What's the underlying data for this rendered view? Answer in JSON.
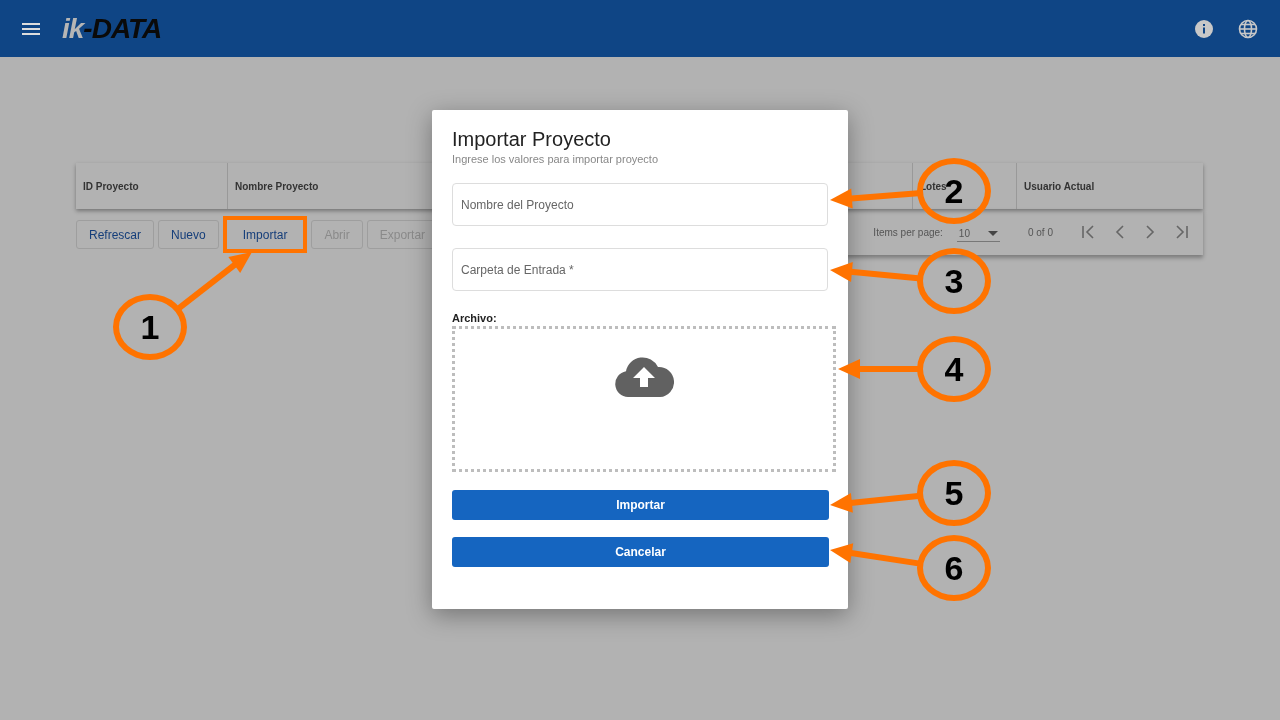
{
  "header": {
    "logo_prefix": "ik",
    "logo_suffix": "-DATA"
  },
  "table": {
    "columns": [
      "ID Proyecto",
      "Nombre Proyecto",
      "Lotes",
      "Usuario Actual"
    ]
  },
  "toolbar": [
    {
      "label": "Refrescar",
      "disabled": false,
      "highlighted": false
    },
    {
      "label": "Nuevo",
      "disabled": false,
      "highlighted": false
    },
    {
      "label": "Importar",
      "disabled": false,
      "highlighted": true
    },
    {
      "label": "Abrir",
      "disabled": true,
      "highlighted": false
    },
    {
      "label": "Exportar",
      "disabled": true,
      "highlighted": false
    }
  ],
  "paginator": {
    "items_per_page_label": "Items per page:",
    "page_size": "10",
    "range": "0 of 0"
  },
  "dialog": {
    "title": "Importar Proyecto",
    "subtitle": "Ingrese los valores para importar proyecto",
    "fields": [
      {
        "placeholder": "Nombre del Proyecto"
      },
      {
        "placeholder": "Carpeta de Entrada *"
      }
    ],
    "file_label": "Archivo:",
    "buttons": [
      "Importar",
      "Cancelar"
    ]
  },
  "callouts": [
    {
      "number": "1"
    },
    {
      "number": "2"
    },
    {
      "number": "3"
    },
    {
      "number": "4"
    },
    {
      "number": "5"
    },
    {
      "number": "6"
    }
  ]
}
